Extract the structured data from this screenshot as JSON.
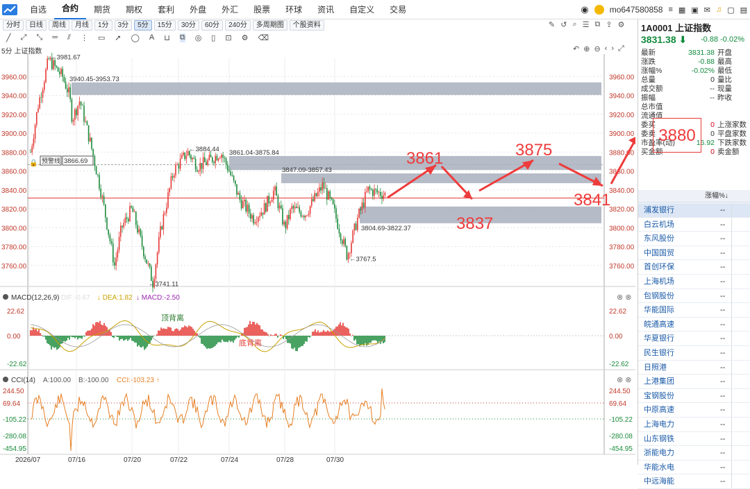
{
  "nav": {
    "items": [
      "自选",
      "合约",
      "期货",
      "期权",
      "套利",
      "外盘",
      "外汇",
      "股票",
      "环球",
      "资讯",
      "自定义",
      "交易"
    ],
    "active": "合约",
    "user": "mo647580858"
  },
  "periods": [
    "分时",
    "日线",
    "周线",
    "月线",
    "1分",
    "3分",
    "5分",
    "15分",
    "30分",
    "60分",
    "240分",
    "多周期图",
    "个股资料"
  ],
  "active_period": "5分",
  "chart_title": "5分 上证指数",
  "main_chart": {
    "type": "candlestick",
    "yaxis_ticks": [
      "3960.00",
      "3940.00",
      "3920.00",
      "3900.00",
      "3880.00",
      "3860.00",
      "3840.00",
      "3820.00",
      "3800.00",
      "3780.00",
      "3760.00"
    ],
    "ylim": [
      3740,
      3980
    ],
    "xaxis_ticks": [
      "2026/07",
      "07/16",
      "07/20",
      "07/22",
      "07/24",
      "07/28",
      "07/30"
    ],
    "labels": {
      "high": "3981.67",
      "low": "3741.11",
      "mid_high": "3884.44",
      "low2": "3767.5",
      "zone1": "3940.45-3953.73",
      "zone2": "3861.04-3875.84",
      "zone3": "3847.09-3857.43",
      "zone4": "3804.69-3822.37",
      "alert_label": "预警线",
      "alert_value": "3866.69"
    },
    "zones": [
      [
        3940.45,
        3953.73
      ],
      [
        3861.04,
        3875.84
      ],
      [
        3847.09,
        3857.43
      ],
      [
        3804.69,
        3822.37
      ]
    ],
    "current_price": 3831.38,
    "annotations": [
      "3861",
      "3875",
      "3837",
      "3841",
      "3880"
    ]
  },
  "macd": {
    "label": "MACD(12,26,9)",
    "dif": "DIF:-0.67",
    "dea": "DEA:1.82",
    "macd": "MACD:-2.50",
    "ticks": [
      "22.62",
      "0.00",
      "-22.62"
    ],
    "annotations": [
      "顶背离",
      "底背离"
    ]
  },
  "cci": {
    "label": "CCI(14)",
    "a": "A:100.00",
    "b": "B:-100.00",
    "cci": "CCI:-103.23",
    "ticks": [
      "244.50",
      "69.64",
      "-105.22",
      "-280.08",
      "-454.95"
    ]
  },
  "quote": {
    "code": "1A0001",
    "name": "上证指数",
    "price": "3831.38",
    "change": "-0.88",
    "pct": "-0.02%",
    "rows": [
      {
        "k": "最新",
        "v": "3831.38",
        "k2": "开盘",
        "color": "#118a3c"
      },
      {
        "k": "涨跌",
        "v": "-0.88",
        "k2": "最高",
        "color": "#118a3c"
      },
      {
        "k": "涨幅%",
        "v": "-0.02%",
        "k2": "最低",
        "color": "#118a3c"
      },
      {
        "k": "总量",
        "v": "0",
        "k2": "量比",
        "color": "#333"
      },
      {
        "k": "成交额",
        "v": "--",
        "k2": "现量",
        "color": "#333"
      },
      {
        "k": "振幅",
        "v": "--",
        "k2": "昨收",
        "color": "#333"
      },
      {
        "k": "总市值",
        "v": "",
        "k2": "",
        "color": "#333"
      },
      {
        "k": "流通值",
        "v": "",
        "k2": "",
        "color": "#333"
      },
      {
        "k": "委买",
        "v": "0",
        "k2": "上涨家数",
        "color": "#d0021b"
      },
      {
        "k": "委卖",
        "v": "0",
        "k2": "平盘家数",
        "color": "#333"
      },
      {
        "k": "市盈率(动)",
        "v": "16.92",
        "k2": "下跌家数",
        "color": "#118a3c"
      },
      {
        "k": "买金额",
        "v": "0",
        "k2": "卖金额",
        "color": "#d0021b"
      }
    ]
  },
  "watchlist": {
    "col": "涨幅%↓",
    "items": [
      "浦发银行",
      "白云机场",
      "东风股份",
      "中国国贸",
      "首创环保",
      "上海机场",
      "包钢股份",
      "华能国际",
      "皖通高速",
      "华夏银行",
      "民生银行",
      "日照港",
      "上港集团",
      "宝钢股份",
      "中原高速",
      "上海电力",
      "山东钢铁",
      "浙能电力",
      "华能水电",
      "中远海能"
    ],
    "value": "--"
  }
}
